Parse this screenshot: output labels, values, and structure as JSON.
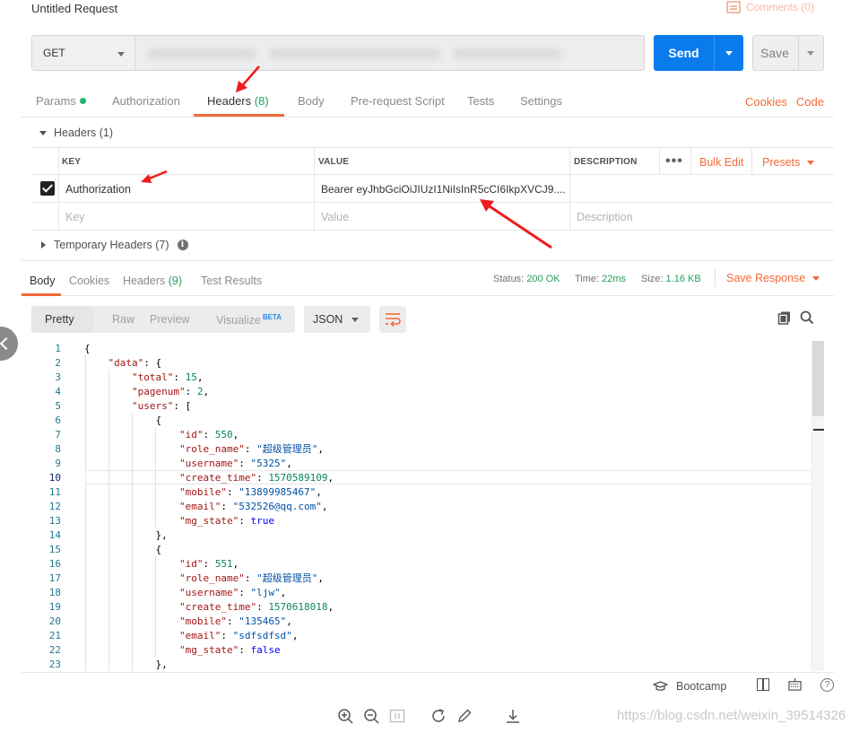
{
  "request": {
    "title": "Untitled Request",
    "comments_label": "Comments (0)",
    "method": "GET",
    "send_label": "Send",
    "save_label": "Save"
  },
  "req_tabs": {
    "params": "Params",
    "authorization": "Authorization",
    "headers": "Headers",
    "headers_count": "(8)",
    "body": "Body",
    "prerequest": "Pre-request Script",
    "tests": "Tests",
    "settings": "Settings",
    "cookies": "Cookies",
    "code": "Code"
  },
  "headers_section": {
    "title": "Headers (1)",
    "col_key": "KEY",
    "col_value": "VALUE",
    "col_description": "DESCRIPTION",
    "more": "•••",
    "bulk_edit": "Bulk Edit",
    "presets": "Presets",
    "rows": [
      {
        "key": "Authorization",
        "value": "Bearer eyJhbGciOiJIUzI1NiIsInR5cCI6IkpXVCJ9....",
        "checked": true
      }
    ],
    "key_placeholder": "Key",
    "value_placeholder": "Value",
    "description_placeholder": "Description",
    "temporary": "Temporary Headers (7)"
  },
  "response": {
    "tabs": {
      "body": "Body",
      "cookies": "Cookies",
      "headers": "Headers",
      "headers_count": "(9)",
      "test_results": "Test Results"
    },
    "status_label": "Status:",
    "status_value": "200 OK",
    "time_label": "Time:",
    "time_value": "22ms",
    "size_label": "Size:",
    "size_value": "1.16 KB",
    "save_response": "Save Response",
    "formats": {
      "pretty": "Pretty",
      "raw": "Raw",
      "preview": "Preview",
      "visualize": "Visualize",
      "beta": "BETA"
    },
    "language": "JSON"
  },
  "code_lines": [
    "{",
    "    \"data\": {",
    "        \"total\": 15,",
    "        \"pagenum\": 2,",
    "        \"users\": [",
    "            {",
    "                \"id\": 550,",
    "                \"role_name\": \"超级管理员\",",
    "                \"username\": \"5325\",",
    "                \"create_time\": 1570589109,",
    "                \"mobile\": \"13899985467\",",
    "                \"email\": \"532526@qq.com\",",
    "                \"mg_state\": true",
    "            },",
    "            {",
    "                \"id\": 551,",
    "                \"role_name\": \"超级管理员\",",
    "                \"username\": \"ljw\",",
    "                \"create_time\": 1570618018,",
    "                \"mobile\": \"135465\",",
    "                \"email\": \"sdfsdfsd\",",
    "                \"mg_state\": false",
    "            },"
  ],
  "footer": {
    "bootcamp": "Bootcamp"
  },
  "watermark": "https://blog.csdn.net/weixin_39514326",
  "colors": {
    "accent": "#f26b3a",
    "send": "#097bed",
    "success": "#24a05b",
    "annotation_arrow": "#ee1c1c"
  }
}
